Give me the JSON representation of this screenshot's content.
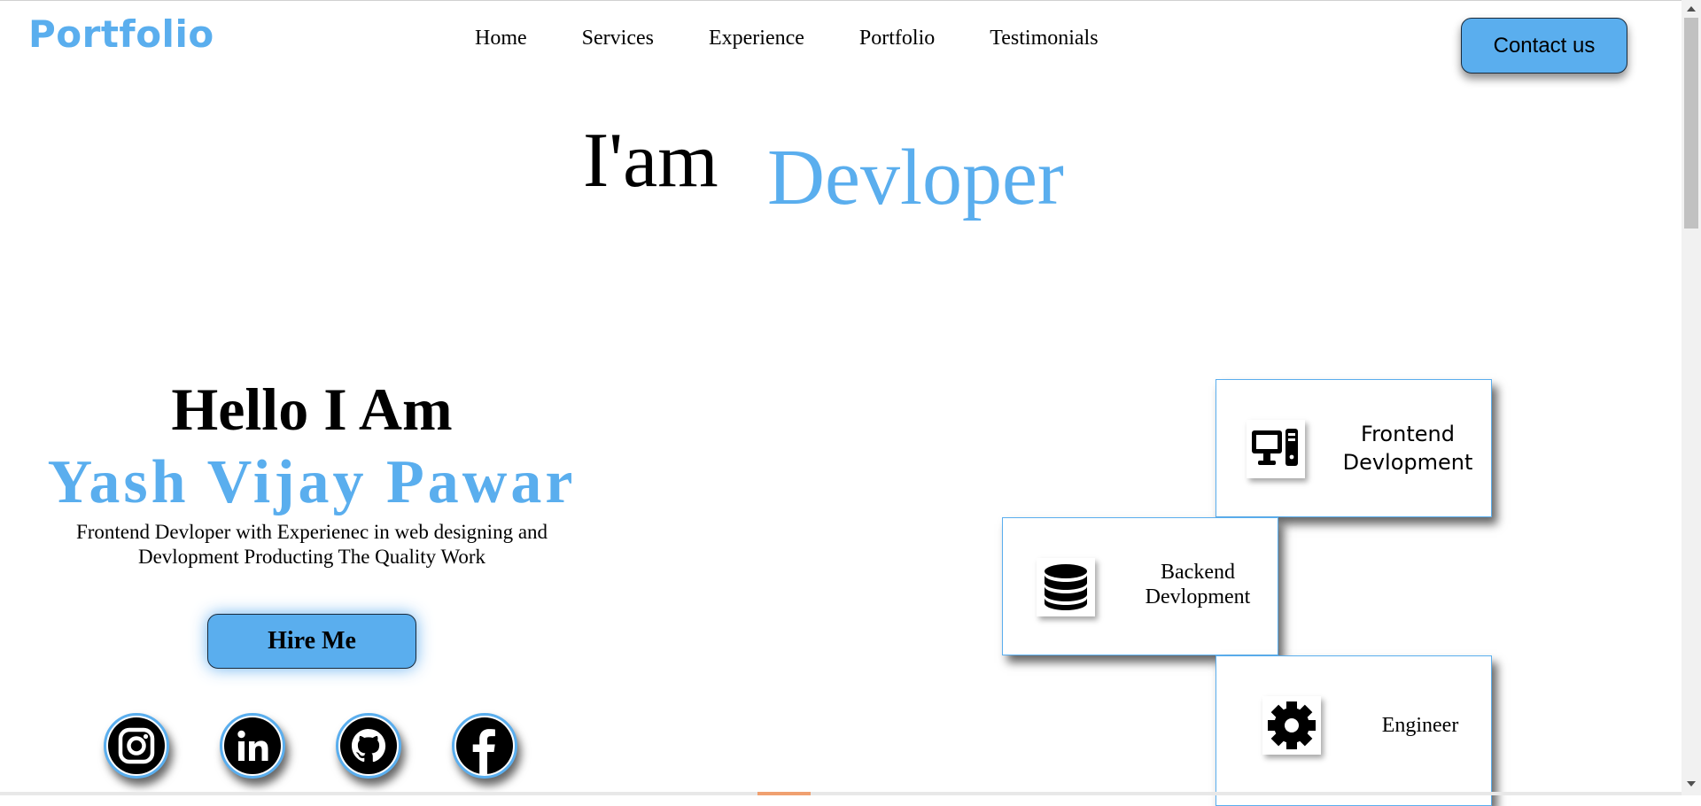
{
  "colors": {
    "accent": "#5aaeee",
    "text": "#000000"
  },
  "navbar": {
    "logo": "Portfolio",
    "links": [
      "Home",
      "Services",
      "Experience",
      "Portfolio",
      "Testimonials"
    ],
    "contact_label": "Contact us"
  },
  "hero": {
    "prefix": "I'am",
    "role": "Devloper"
  },
  "intro": {
    "greeting": "Hello I Am",
    "name": "Yash Vijay Pawar",
    "description": "Frontend Devloper with Experienec in web designing and Devlopment Producting The Quality Work",
    "hire_label": "Hire Me",
    "socials": [
      "instagram-icon",
      "linkedin-icon",
      "github-icon",
      "facebook-icon"
    ]
  },
  "services": [
    {
      "icon": "computer-icon",
      "label": "Frontend Devlopment"
    },
    {
      "icon": "database-icon",
      "label": "Backend Devlopment"
    },
    {
      "icon": "gear-icon",
      "label": "Engineer"
    }
  ]
}
